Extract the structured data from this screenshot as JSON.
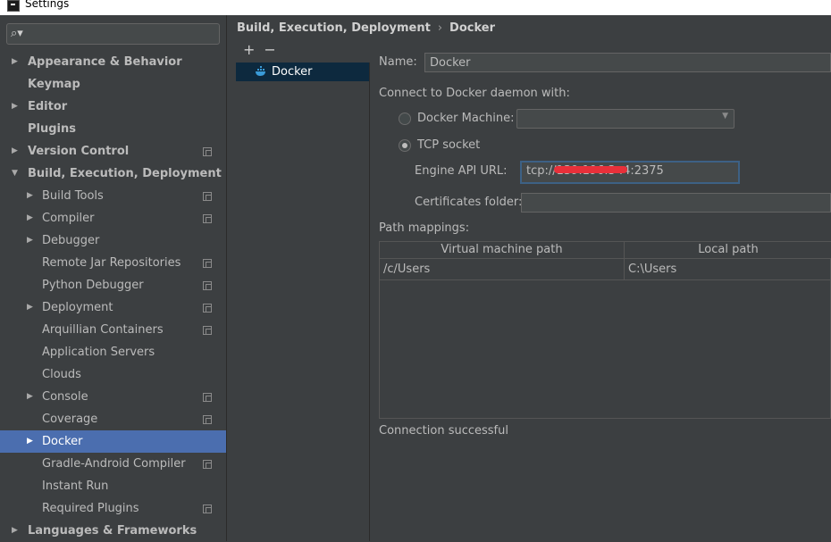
{
  "window": {
    "title": "Settings"
  },
  "search": {
    "placeholder": ""
  },
  "sidebar": {
    "items": [
      {
        "label": "Appearance & Behavior",
        "arrow": "▶"
      },
      {
        "label": "Keymap",
        "arrow": ""
      },
      {
        "label": "Editor",
        "arrow": "▶"
      },
      {
        "label": "Plugins",
        "arrow": ""
      },
      {
        "label": "Version Control",
        "arrow": "▶"
      },
      {
        "label": "Build, Execution, Deployment",
        "arrow": "▼"
      },
      {
        "label": "Build Tools",
        "arrow": "▶"
      },
      {
        "label": "Compiler",
        "arrow": "▶"
      },
      {
        "label": "Debugger",
        "arrow": "▶"
      },
      {
        "label": "Remote Jar Repositories",
        "arrow": ""
      },
      {
        "label": "Python Debugger",
        "arrow": ""
      },
      {
        "label": "Deployment",
        "arrow": "▶"
      },
      {
        "label": "Arquillian Containers",
        "arrow": ""
      },
      {
        "label": "Application Servers",
        "arrow": ""
      },
      {
        "label": "Clouds",
        "arrow": ""
      },
      {
        "label": "Console",
        "arrow": "▶"
      },
      {
        "label": "Coverage",
        "arrow": ""
      },
      {
        "label": "Docker",
        "arrow": "▶"
      },
      {
        "label": "Gradle-Android Compiler",
        "arrow": ""
      },
      {
        "label": "Instant Run",
        "arrow": ""
      },
      {
        "label": "Required Plugins",
        "arrow": ""
      },
      {
        "label": "Languages & Frameworks",
        "arrow": "▶"
      }
    ]
  },
  "breadcrumb": {
    "parent": "Build, Execution, Deployment",
    "separator": "›",
    "current": "Docker"
  },
  "list": {
    "add": "+",
    "remove": "−",
    "items": [
      {
        "label": "Docker"
      }
    ]
  },
  "form": {
    "name_label": "Name:",
    "name_value": "Docker",
    "connect_label": "Connect to Docker daemon with:",
    "docker_machine_label": "Docker Machine:",
    "docker_machine_value": "",
    "tcp_label": "TCP socket",
    "engine_label": "Engine API URL:",
    "engine_value": "tcp://139.196.3 .4:2375",
    "cert_label": "Certificates folder:",
    "cert_value": "",
    "path_mappings_label": "Path mappings:",
    "table": {
      "headers": [
        "Virtual machine path",
        "Local path"
      ],
      "rows": [
        [
          "/c/Users",
          "C:\\Users"
        ]
      ]
    },
    "status": "Connection successful"
  },
  "colors": {
    "selection": "#4b6eaf",
    "list_selection": "#0d293e",
    "background": "#3c3f41",
    "redaction": "#e8303a"
  }
}
